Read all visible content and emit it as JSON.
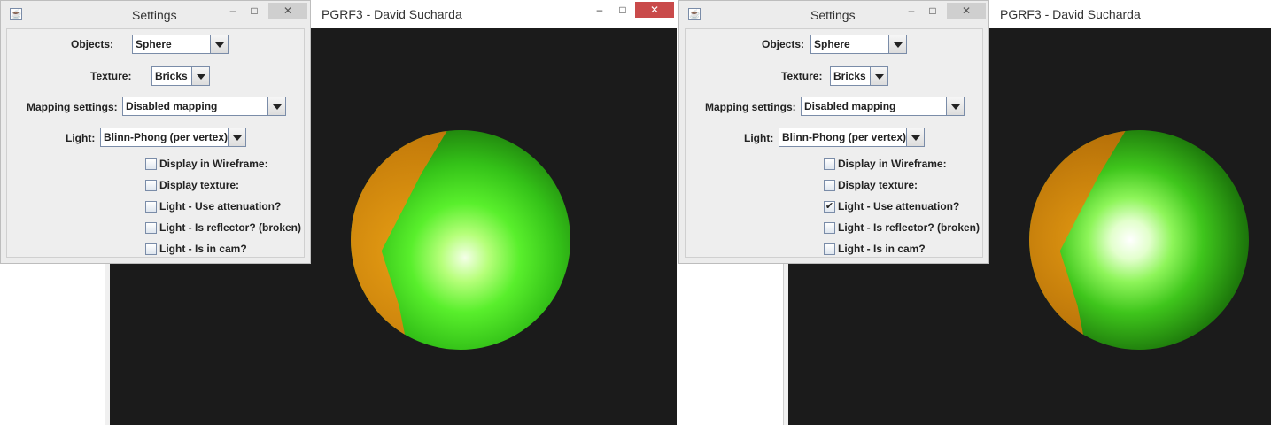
{
  "panels": [
    {
      "render_title": "PGRF3 - David Sucharda",
      "render_close": "✕",
      "render_minimize": "–",
      "render_maximize": "□",
      "settings": {
        "title": "Settings",
        "minimize": "–",
        "maximize": "□",
        "close": "✕",
        "objects_label": "Objects:",
        "objects_value": "Sphere",
        "texture_label": "Texture:",
        "texture_value": "Bricks",
        "mapping_label": "Mapping settings:",
        "mapping_value": "Disabled mapping",
        "light_label": "Light:",
        "light_value": "Blinn-Phong (per vertex)",
        "checkboxes": [
          {
            "label": "Display in Wireframe:",
            "checked": false
          },
          {
            "label": "Display texture:",
            "checked": false
          },
          {
            "label": "Light - Use attenuation?",
            "checked": false
          },
          {
            "label": "Light - Is reflector? (broken)",
            "checked": false
          },
          {
            "label": "Light - Is in cam?",
            "checked": false
          }
        ]
      }
    },
    {
      "render_title": "PGRF3 - David Sucharda",
      "render_close": "✕",
      "render_minimize": "–",
      "render_maximize": "□",
      "settings": {
        "title": "Settings",
        "minimize": "–",
        "maximize": "□",
        "close": "✕",
        "objects_label": "Objects:",
        "objects_value": "Sphere",
        "texture_label": "Texture:",
        "texture_value": "Bricks",
        "mapping_label": "Mapping settings:",
        "mapping_value": "Disabled mapping",
        "light_label": "Light:",
        "light_value": "Blinn-Phong (per vertex)",
        "checkboxes": [
          {
            "label": "Display in Wireframe:",
            "checked": false
          },
          {
            "label": "Display texture:",
            "checked": false
          },
          {
            "label": "Light - Use attenuation?",
            "checked": true
          },
          {
            "label": "Light - Is reflector? (broken)",
            "checked": false
          },
          {
            "label": "Light - Is in cam?",
            "checked": false
          }
        ]
      }
    }
  ],
  "checkmark": "✔",
  "java_icon_glyph": "☕",
  "colors": {
    "canvas": "#1b1b1b",
    "sphere_green": "#3fbf1f",
    "sphere_orange": "#d78a0a",
    "close_red": "#c94a4a"
  }
}
